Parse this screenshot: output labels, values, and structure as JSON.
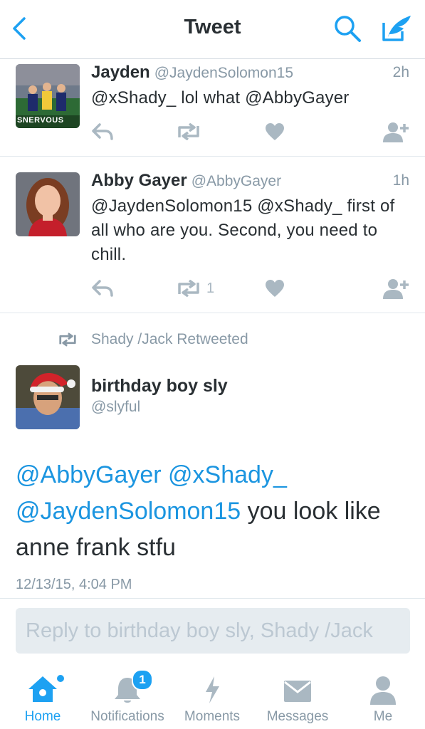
{
  "header": {
    "title": "Tweet"
  },
  "tweets": [
    {
      "name": "Jayden",
      "handle": "@JaydenSolomon15",
      "time": "2h",
      "text": "@xShady_ lol what @AbbyGayer",
      "retweets": "",
      "avatar_caption": "SNERVOUS"
    },
    {
      "name": "Abby Gayer",
      "handle": "@AbbyGayer",
      "time": "1h",
      "text": "@JaydenSolomon15 @xShady_  first of all who are you. Second, you need to chill.",
      "retweets": "1"
    }
  ],
  "focus": {
    "retweet_context": "Shady /Jack Retweeted",
    "name": "birthday boy sly",
    "handle": "@slyful",
    "mentions": "@AbbyGayer @xShady_ @JaydenSolomon15",
    "text": " you look like anne frank stfu",
    "timestamp": "12/13/15, 4:04 PM"
  },
  "reply": {
    "placeholder": "Reply to birthday boy sly, Shady /Jack"
  },
  "tabs": [
    {
      "label": "Home",
      "icon": "home-icon",
      "active": true
    },
    {
      "label": "Notifications",
      "icon": "bell-icon",
      "badge": "1"
    },
    {
      "label": "Moments",
      "icon": "lightning-icon"
    },
    {
      "label": "Messages",
      "icon": "envelope-icon"
    },
    {
      "label": "Me",
      "icon": "person-icon"
    }
  ],
  "colors": {
    "accent": "#1da1f2",
    "mention": "#1b95e0",
    "muted": "#8899a6",
    "icon": "#aab8c2"
  }
}
